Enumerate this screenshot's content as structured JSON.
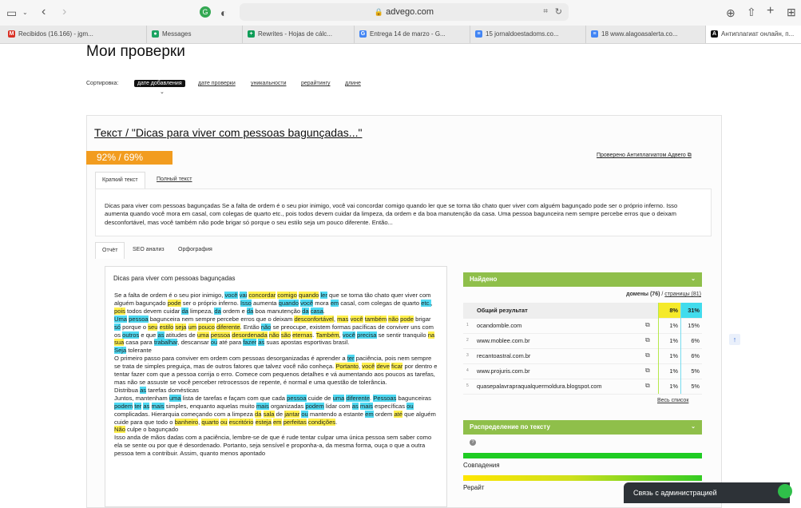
{
  "browser": {
    "url": "advego.com",
    "tabs": [
      {
        "label": "Recibidos (16.166) - jgm...",
        "fav": "M",
        "color": "#d93025"
      },
      {
        "label": "Messages",
        "fav": "●",
        "color": "#1aa260"
      },
      {
        "label": "Rewrites - Hojas de cálc...",
        "fav": "+",
        "color": "#0f9d58"
      },
      {
        "label": "Entrega 14 de marzo - G...",
        "fav": "G",
        "color": "#4285f4"
      },
      {
        "label": "15 jornaldoestadoms.co...",
        "fav": "≡",
        "color": "#4285f4"
      },
      {
        "label": "18 www.alagoasalerta.co...",
        "fav": "≡",
        "color": "#4285f4"
      },
      {
        "label": "Антиплагиат онлайн, п...",
        "fav": "A",
        "color": "#111111"
      }
    ]
  },
  "page": {
    "title": "Мои проверки",
    "sort_label": "Сортировка:",
    "sort_options": [
      "дате добавления",
      "дате проверки",
      "уникальности",
      "рерайтингу",
      "длине"
    ],
    "text_title": "Текст / \"Dicas para viver com pessoas bagunçadas...\"",
    "score": "92% / 69%",
    "checked_by": "Проверено Антиплагиатом Адвего",
    "text_tabs": [
      "Краткий текст",
      "Полный текст"
    ],
    "short_text": "Dicas para viver com pessoas bagunçadas Se a falta de ordem é o seu pior inimigo, você vai concordar comigo quando ler que se torna tão chato quer viver com alguém bagunçado pode ser o próprio inferno. Isso aumenta quando você mora em casal, com colegas de quarto etc., pois todos devem cuidar da limpeza, da ordem e da boa manutenção da casa. Uma pessoa bagunceira nem sempre percebe erros que o deixam desconfortável, mas você também não pode brigar só porque o seu estilo seja um pouco diferente. Então...",
    "report_tabs": [
      "Отчёт",
      "SEO анализ",
      "Орфография"
    ],
    "report_heading": "Dicas para viver com pessoas bagunçadas"
  },
  "found": {
    "header": "Найдено",
    "domains_label": "домены (76)",
    "sep": "/",
    "pages_label": "страницы (81)",
    "total": {
      "label": "Общий результат",
      "p1": "8%",
      "p2": "31%"
    },
    "rows": [
      {
        "num": "1",
        "domain": "ocandomble.com",
        "p1": "1%",
        "p2": "15%"
      },
      {
        "num": "2",
        "domain": "www.moblee.com.br",
        "p1": "1%",
        "p2": "6%"
      },
      {
        "num": "3",
        "domain": "recantoastral.com.br",
        "p1": "1%",
        "p2": "6%"
      },
      {
        "num": "4",
        "domain": "www.projuris.com.br",
        "p1": "1%",
        "p2": "5%"
      },
      {
        "num": "5",
        "domain": "quasepalavrapraqualquermoldura.blogspot.com",
        "p1": "1%",
        "p2": "5%"
      }
    ],
    "all_list": "Весь список"
  },
  "distribution": {
    "header": "Распределение по тексту",
    "help": "?",
    "matches_label": "Совпадения",
    "rewrite_label": "Рерайт"
  },
  "widget": {
    "contact": "Связь с администрацией",
    "scroll_up": "↑"
  },
  "colors": {
    "accent_green": "#8fbf4a",
    "score_orange": "#f29c1f",
    "highlight_yellow": "#fff04d",
    "highlight_cyan": "#4fd9f2"
  }
}
